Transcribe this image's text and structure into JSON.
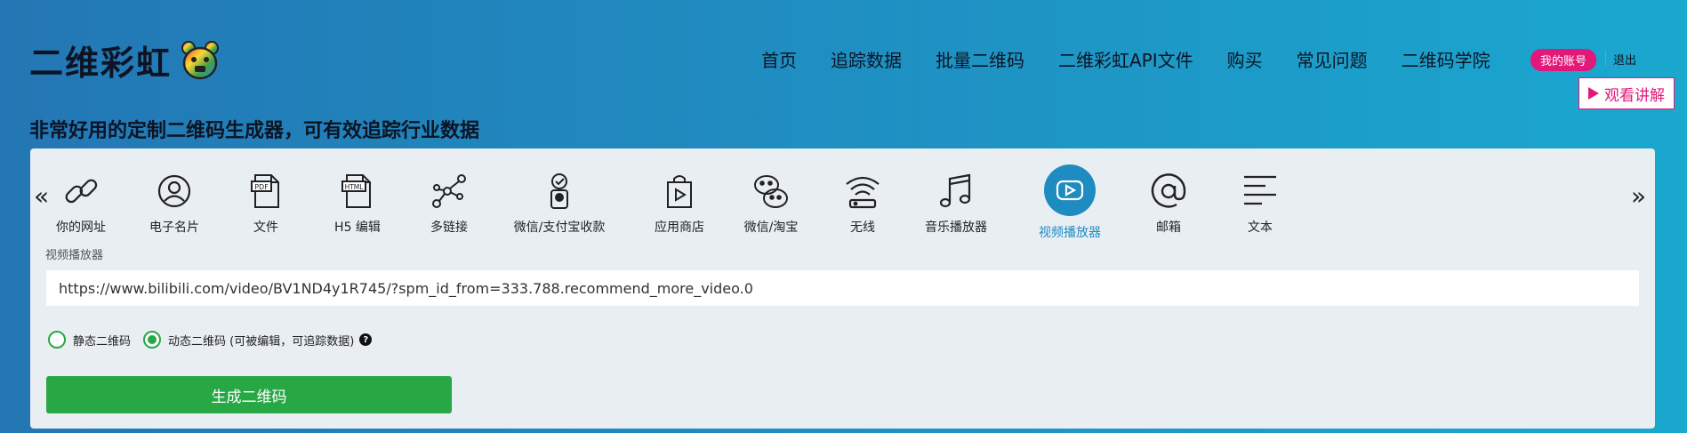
{
  "header": {
    "logo_text": "二维彩虹",
    "nav": [
      "首页",
      "追踪数据",
      "批量二维码",
      "二维彩虹API文件",
      "购买",
      "常见问题",
      "二维码学院"
    ],
    "account_label": "我的账号",
    "logout_label": "退出",
    "watch_label": "观看讲解"
  },
  "tagline": "非常好用的定制二维码生成器，可有效追踪行业数据",
  "tabs": [
    {
      "label": "你的网址",
      "icon": "link-icon"
    },
    {
      "label": "电子名片",
      "icon": "user-icon"
    },
    {
      "label": "文件",
      "icon": "pdf-icon"
    },
    {
      "label": "H5 编辑",
      "icon": "html-icon"
    },
    {
      "label": "多链接",
      "icon": "multi-link-icon"
    },
    {
      "label": "微信/支付宝收款",
      "icon": "payment-icon"
    },
    {
      "label": "应用商店",
      "icon": "app-store-icon"
    },
    {
      "label": "微信/淘宝",
      "icon": "wechat-icon"
    },
    {
      "label": "无线",
      "icon": "wifi-icon"
    },
    {
      "label": "音乐播放器",
      "icon": "music-icon"
    },
    {
      "label": "视频播放器",
      "icon": "video-icon",
      "active": true
    },
    {
      "label": "邮箱",
      "icon": "email-icon"
    },
    {
      "label": "文本",
      "icon": "text-icon"
    }
  ],
  "form": {
    "section_label": "视频播放器",
    "url_value": "https://www.bilibili.com/video/BV1ND4y1R745/?spm_id_from=333.788.recommend_more_video.0",
    "radio_static": "静态二维码",
    "radio_dynamic": "动态二维码 (可被编辑，可追踪数据)",
    "selected": "dynamic",
    "generate_label": "生成二维码"
  },
  "colors": {
    "accent": "#1e8cc0",
    "button": "#28a745",
    "account": "#e2187a"
  }
}
